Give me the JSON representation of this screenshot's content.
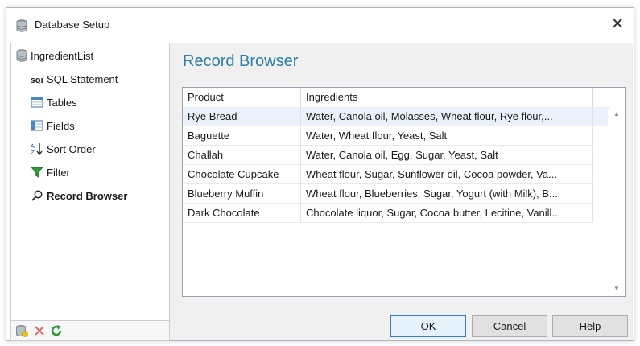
{
  "window": {
    "title": "Database Setup",
    "close_glyph": "✕"
  },
  "sidebar": {
    "root": {
      "label": "IngredientList",
      "icon": "database-icon"
    },
    "items": [
      {
        "label": "SQL Statement",
        "icon": "sql-icon"
      },
      {
        "label": "Tables",
        "icon": "table-icon"
      },
      {
        "label": "Fields",
        "icon": "fields-icon"
      },
      {
        "label": "Sort Order",
        "icon": "sort-icon"
      },
      {
        "label": "Filter",
        "icon": "filter-icon"
      },
      {
        "label": "Record Browser",
        "icon": "search-icon",
        "selected": true
      }
    ],
    "bottom_buttons": [
      "add-database-icon",
      "delete-icon",
      "refresh-icon"
    ]
  },
  "main": {
    "title": "Record Browser",
    "grid": {
      "columns": [
        "Product",
        "Ingredients"
      ],
      "rows": [
        [
          "Rye Bread",
          "Water, Canola oil, Molasses, Wheat flour, Rye flour,..."
        ],
        [
          "Baguette",
          "Water, Wheat flour, Yeast, Salt"
        ],
        [
          "Challah",
          "Water, Canola oil, Egg, Sugar, Yeast, Salt"
        ],
        [
          "Chocolate Cupcake",
          "Wheat flour, Sugar, Sunflower oil, Cocoa powder, Va..."
        ],
        [
          "Blueberry Muffin",
          "Wheat flour, Blueberries, Sugar, Yogurt (with Milk), B..."
        ],
        [
          "Dark Chocolate",
          "Chocolate liquor, Sugar, Cocoa butter, Lecitine, Vanill..."
        ]
      ]
    }
  },
  "buttons": {
    "ok": "OK",
    "cancel": "Cancel",
    "help": "Help"
  },
  "colors": {
    "accent": "#2b7fa4",
    "selected_row": "#eaf1fb",
    "default_button_border": "#2f7bd6"
  }
}
